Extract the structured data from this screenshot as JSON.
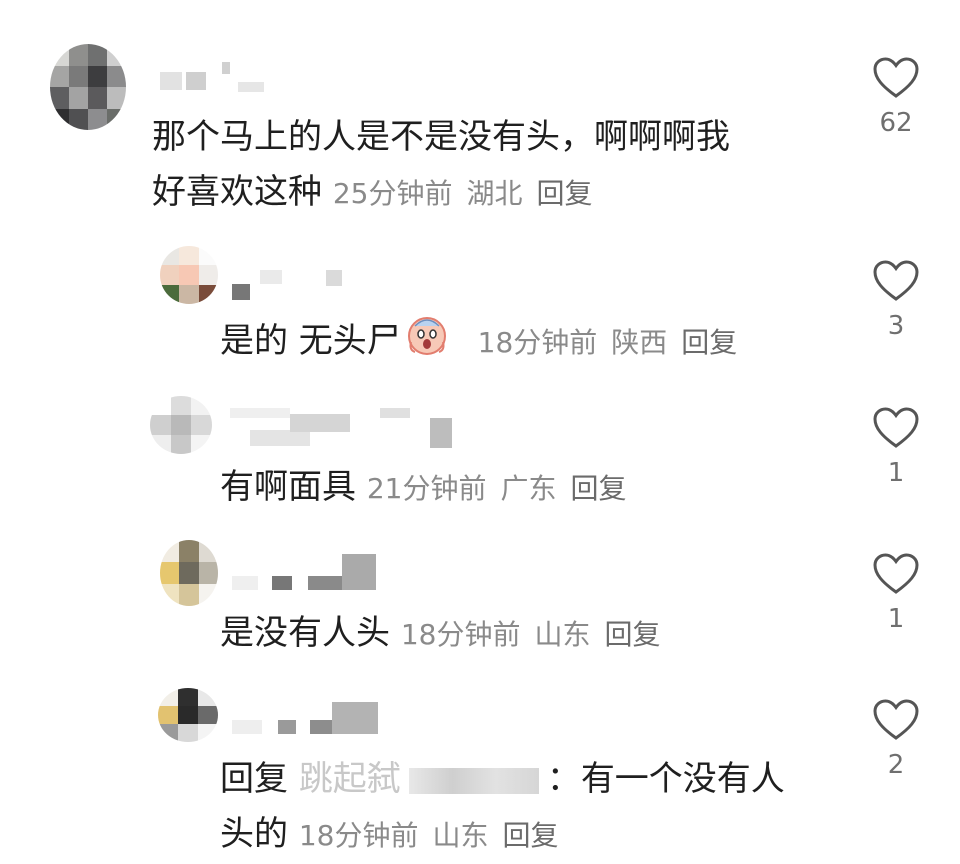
{
  "comments": [
    {
      "text": "那个马上的人是不是没有头，啊啊啊我好喜欢这种",
      "line1": "那个马上的人是不是没有头，啊啊啊我",
      "line2": "好喜欢这种",
      "time": "25分钟前",
      "location": "湖北",
      "reply_label": "回复",
      "likes": "62"
    },
    {
      "text": "是的 无头尸",
      "emoji": "screaming-face",
      "time": "18分钟前",
      "location": "陕西",
      "reply_label": "回复",
      "likes": "3"
    },
    {
      "text": "有啊面具",
      "time": "21分钟前",
      "location": "广东",
      "reply_label": "回复",
      "likes": "1"
    },
    {
      "text": "是没有人头",
      "time": "18分钟前",
      "location": "山东",
      "reply_label": "回复",
      "likes": "1"
    },
    {
      "reply_prefix": "回复",
      "reply_target_partial": "跳起弑",
      "reply_colon": "：",
      "text_line1": "有一个没有人",
      "text_line2": "头的",
      "time": "18分钟前",
      "location": "山东",
      "reply_label": "回复",
      "likes": "2"
    }
  ],
  "colors": {
    "text": "#1f1f1f",
    "meta": "#8a8a8a",
    "icon": "#555555"
  }
}
